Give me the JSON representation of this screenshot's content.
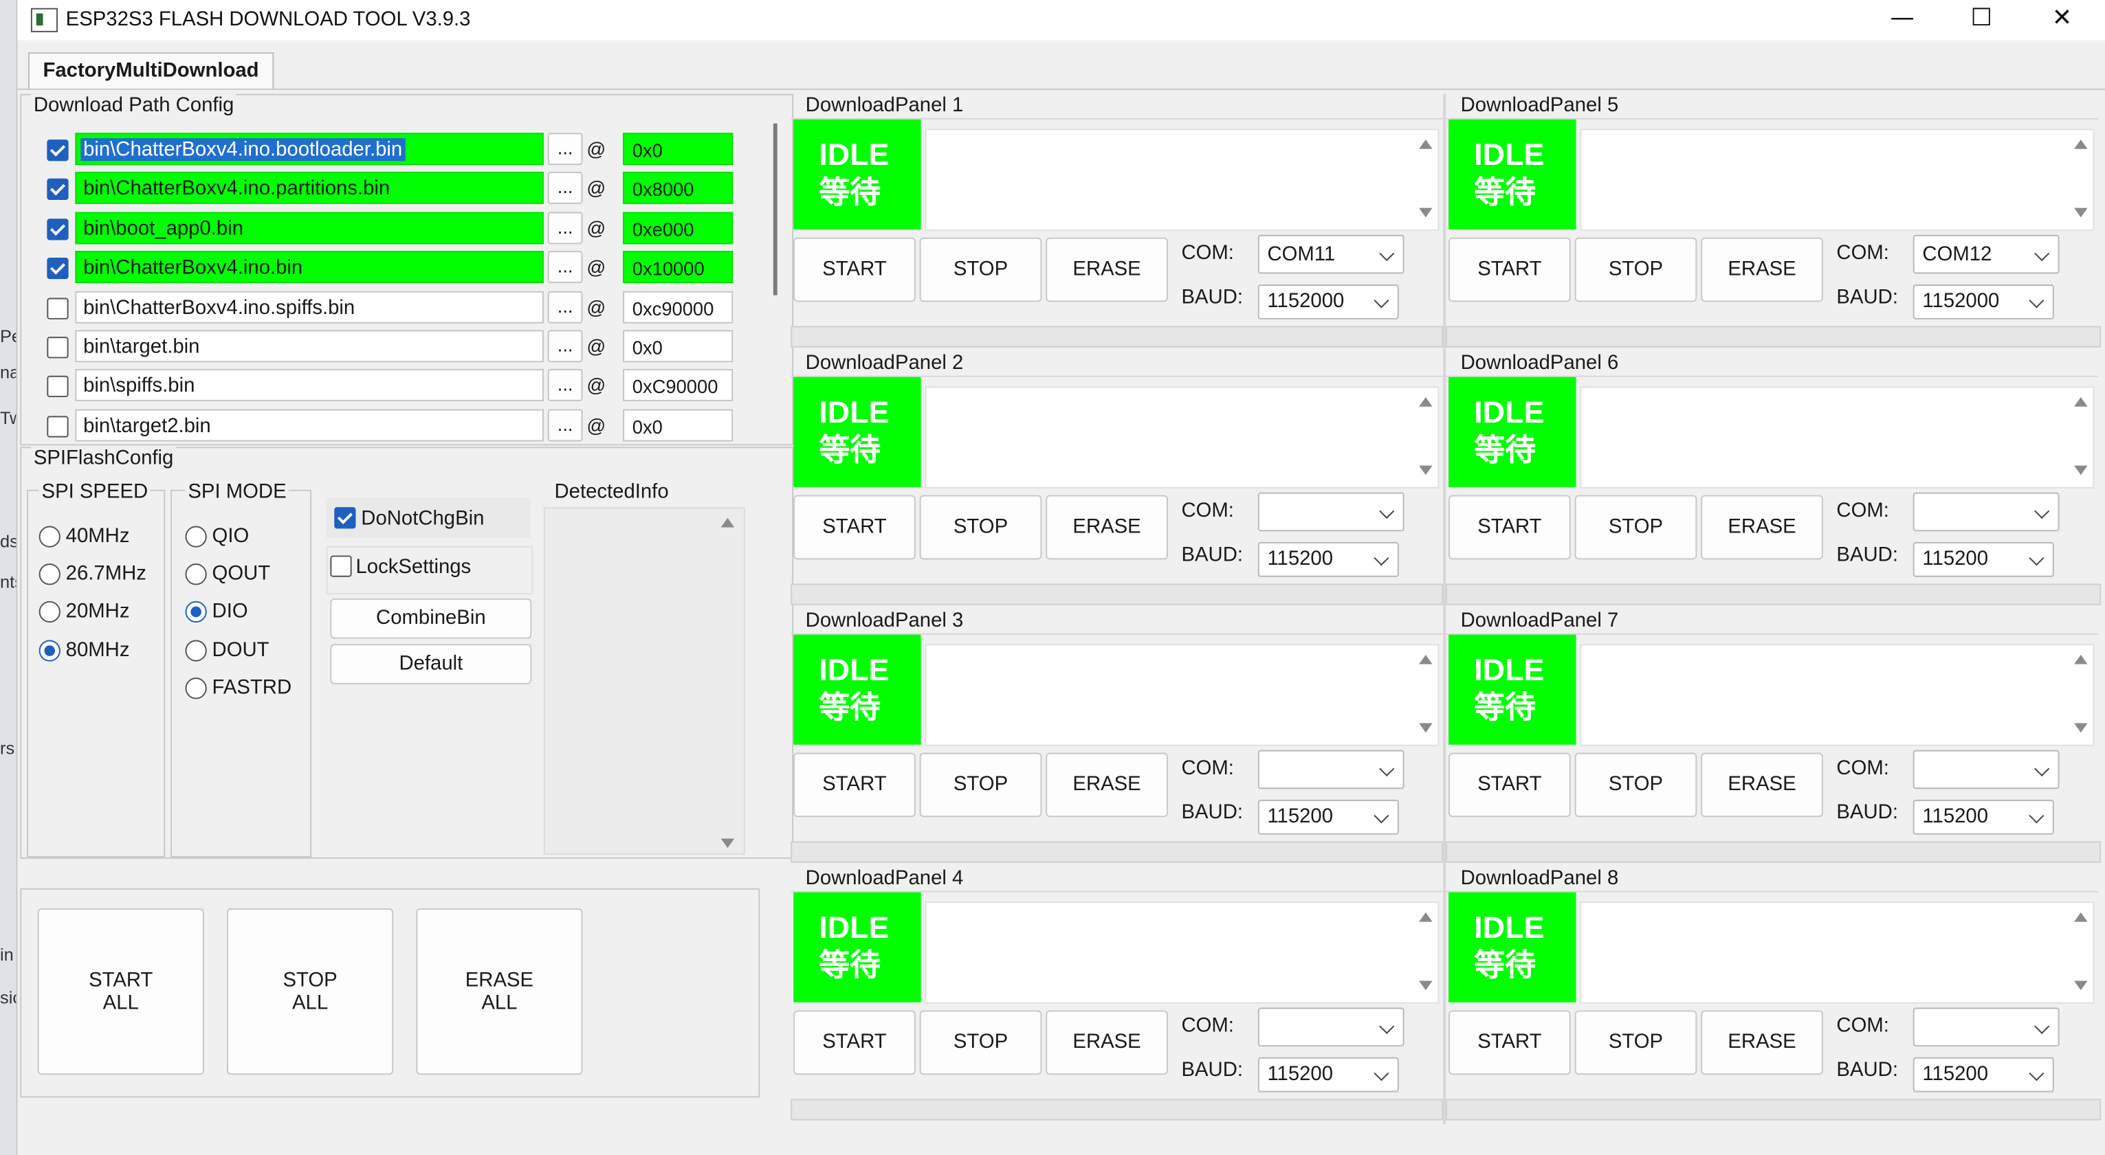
{
  "window": {
    "title": "ESP32S3 FLASH DOWNLOAD TOOL V3.9.3",
    "minimize_glyph": "—",
    "maximize_glyph": "☐",
    "close_glyph": "✕"
  },
  "left_strip": [
    "Pe",
    "na",
    "Tw",
    "ds",
    "nts",
    "rs",
    "in",
    "sic"
  ],
  "tab": {
    "label": "FactoryMultiDownload"
  },
  "download_path_config": {
    "label": "Download Path Config",
    "dots_label": "...",
    "at_label": "@",
    "rows": [
      {
        "checked": true,
        "path": "bin\\ChatterBoxv4.ino.bootloader.bin",
        "address": "0x0",
        "green": true,
        "selected": true
      },
      {
        "checked": true,
        "path": "bin\\ChatterBoxv4.ino.partitions.bin",
        "address": "0x8000",
        "green": true,
        "selected": false
      },
      {
        "checked": true,
        "path": "bin\\boot_app0.bin",
        "address": "0xe000",
        "green": true,
        "selected": false
      },
      {
        "checked": true,
        "path": "bin\\ChatterBoxv4.ino.bin",
        "address": "0x10000",
        "green": true,
        "selected": false
      },
      {
        "checked": false,
        "path": "bin\\ChatterBoxv4.ino.spiffs.bin",
        "address": "0xc90000",
        "green": false,
        "selected": false
      },
      {
        "checked": false,
        "path": "bin\\target.bin",
        "address": "0x0",
        "green": false,
        "selected": false
      },
      {
        "checked": false,
        "path": "bin\\spiffs.bin",
        "address": "0xC90000",
        "green": false,
        "selected": false
      },
      {
        "checked": false,
        "path": "bin\\target2.bin",
        "address": "0x0",
        "green": false,
        "selected": false
      }
    ]
  },
  "spi_flash_config": {
    "label": "SPIFlashConfig",
    "spi_speed": {
      "label": "SPI SPEED",
      "options": [
        "40MHz",
        "26.7MHz",
        "20MHz",
        "80MHz"
      ],
      "selected": "80MHz"
    },
    "spi_mode": {
      "label": "SPI MODE",
      "options": [
        "QIO",
        "QOUT",
        "DIO",
        "DOUT",
        "FASTRD"
      ],
      "selected": "DIO"
    },
    "do_not_chg_bin": {
      "label": "DoNotChgBin",
      "checked": true
    },
    "lock_settings": {
      "label": "LockSettings",
      "checked": false
    },
    "combine_bin_label": "CombineBin",
    "default_label": "Default",
    "detected_info_label": "DetectedInfo"
  },
  "global_buttons": {
    "start_all": [
      "START",
      "ALL"
    ],
    "stop_all": [
      "STOP",
      "ALL"
    ],
    "erase_all": [
      "ERASE",
      "ALL"
    ]
  },
  "panel_labels": {
    "status_line1": "IDLE",
    "status_line2": "等待",
    "start": "START",
    "stop": "STOP",
    "erase": "ERASE",
    "com": "COM:",
    "baud": "BAUD:"
  },
  "panels": [
    {
      "title": "DownloadPanel 1",
      "com": "COM11",
      "baud": "1152000"
    },
    {
      "title": "DownloadPanel 2",
      "com": "",
      "baud": "115200"
    },
    {
      "title": "DownloadPanel 3",
      "com": "",
      "baud": "115200"
    },
    {
      "title": "DownloadPanel 4",
      "com": "",
      "baud": "115200"
    },
    {
      "title": "DownloadPanel 5",
      "com": "COM12",
      "baud": "1152000"
    },
    {
      "title": "DownloadPanel 6",
      "com": "",
      "baud": "115200"
    },
    {
      "title": "DownloadPanel 7",
      "com": "",
      "baud": "115200"
    },
    {
      "title": "DownloadPanel 8",
      "com": "",
      "baud": "115200"
    }
  ],
  "colors": {
    "idle_green": "#00ff00",
    "accent_blue": "#1f5fbf"
  }
}
